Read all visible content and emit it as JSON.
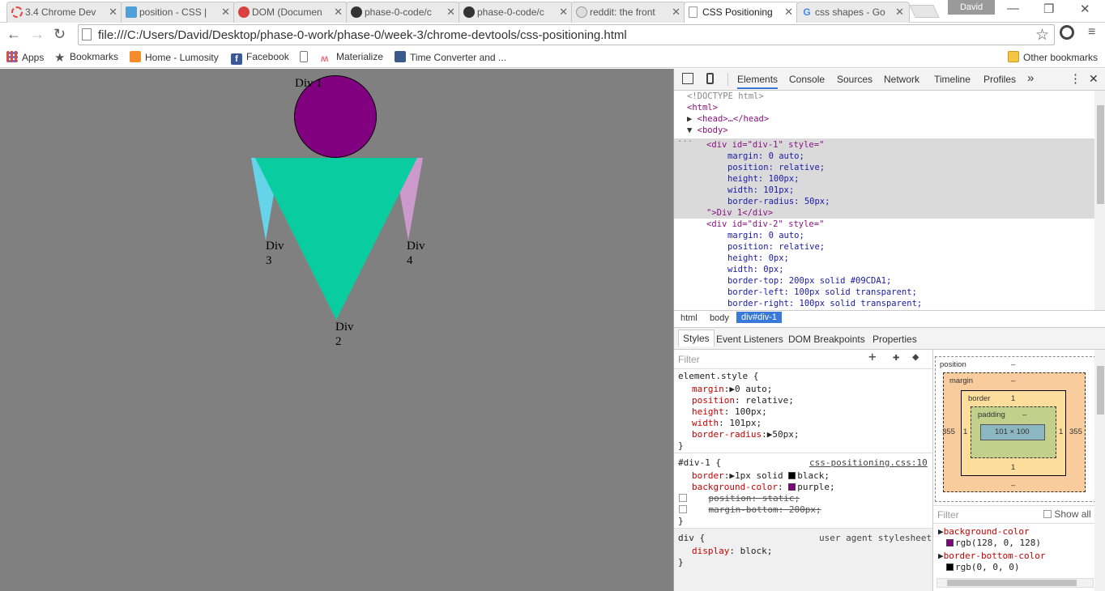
{
  "tabs": [
    {
      "label": "3.4 Chrome Dev",
      "favicon_color": "#e04a3f"
    },
    {
      "label": "position - CSS |",
      "favicon_color": "#4f9fd9"
    },
    {
      "label": "DOM (Documen",
      "favicon_color": "#d9413e"
    },
    {
      "label": "phase-0-code/c",
      "favicon_color": "#333333"
    },
    {
      "label": "phase-0-code/c",
      "favicon_color": "#333333"
    },
    {
      "label": "reddit: the front",
      "favicon_color": "#cccccc"
    },
    {
      "label": "CSS Positioning",
      "favicon_color": "#999999"
    },
    {
      "label": "css shapes - Go",
      "favicon_color": "#4285f4"
    }
  ],
  "profile": "David",
  "address": {
    "url": "file:///C:/Users/David/Desktop/phase-0-work/phase-0/week-3/chrome-devtools/css-positioning.html"
  },
  "bookmarks": [
    {
      "label": "Apps",
      "icon": "apps-icon"
    },
    {
      "label": "Bookmarks",
      "icon": "star-icon"
    },
    {
      "label": "Home - Lumosity",
      "icon": "lumosity-icon"
    },
    {
      "label": "Facebook",
      "icon": "facebook-icon"
    },
    {
      "label": "",
      "icon": "page-icon"
    },
    {
      "label": "Materialize",
      "icon": "materialize-icon"
    },
    {
      "label": "Time Converter and ...",
      "icon": "clock-icon"
    }
  ],
  "other_bookmarks": "Other bookmarks",
  "page": {
    "div1": "Div 1",
    "div2_a": "Div",
    "div2_b": "2",
    "div3_a": "Div",
    "div3_b": "3",
    "div4_a": "Div",
    "div4_b": "4",
    "colors": {
      "background": "#808080",
      "div1": "#800080",
      "div2": "#09CDA1",
      "div3": "#66D4E8",
      "div4": "#CC99CC"
    }
  },
  "devtools": {
    "tabs": [
      "Elements",
      "Console",
      "Sources",
      "Network",
      "Timeline",
      "Profiles"
    ],
    "more": "»",
    "dom": {
      "doctype": "<!DOCTYPE html>",
      "html": "<html>",
      "head": "<head>…</head>",
      "body": "<body>",
      "div1_open": "<div id=\"div-1\" style=\"",
      "div1_lines": [
        "margin: 0 auto;",
        "position: relative;",
        "height: 100px;",
        "width: 101px;",
        "border-radius: 50px;"
      ],
      "div1_close": "\">Div 1</div>",
      "div2_open": "<div id=\"div-2\" style=\"",
      "div2_lines": [
        "margin: 0 auto;",
        "position: relative;",
        "height: 0px;",
        "width: 0px;",
        "border-top: 200px solid #09CDA1;",
        "border-left: 100px solid transparent;",
        "border-right: 100px solid transparent;"
      ]
    },
    "breadcrumbs": [
      "html",
      "body",
      "div#div-1"
    ],
    "style_tabs": [
      "Styles",
      "Event Listeners",
      "DOM Breakpoints",
      "Properties"
    ],
    "filter_placeholder": "Filter",
    "styles": {
      "element_style": "element.style {",
      "el_props": [
        {
          "name": "margin",
          "value": "0 auto;"
        },
        {
          "name": "position",
          "value": "relative;"
        },
        {
          "name": "height",
          "value": "100px;"
        },
        {
          "name": "width",
          "value": "101px;"
        },
        {
          "name": "border-radius",
          "value": "50px;"
        }
      ],
      "close": "}",
      "div1_selector": "#div-1 {",
      "div1_source": "css-positioning.css:10",
      "div1_props": [
        {
          "name": "border",
          "value": "1px solid",
          "color": "black;"
        },
        {
          "name": "background-color",
          "value": "",
          "color": "purple;"
        },
        {
          "name": "position",
          "value": "static;"
        },
        {
          "name": "margin-bottom",
          "value": "200px;"
        }
      ],
      "ua_selector": "div {",
      "ua_source": "user agent stylesheet",
      "ua_props": [
        {
          "name": "display",
          "value": "block;"
        }
      ]
    },
    "boxmodel": {
      "position": "position",
      "position_val": "–",
      "margin": "margin",
      "margin_val": "–",
      "border": "border",
      "border_val": "1",
      "padding": "padding",
      "padding_val": "–",
      "content": "101 × 100",
      "left_margin": "355",
      "right_margin": "355",
      "left_border": "1",
      "right_border": "1"
    },
    "computed": {
      "filter_placeholder": "Filter",
      "show_all": "Show all",
      "props": [
        {
          "name": "background-color",
          "value": "rgb(128, 0, 128)",
          "swatch": "#800080"
        },
        {
          "name": "border-bottom-color",
          "value": "rgb(0, 0, 0)",
          "swatch": "#000000"
        }
      ]
    }
  }
}
